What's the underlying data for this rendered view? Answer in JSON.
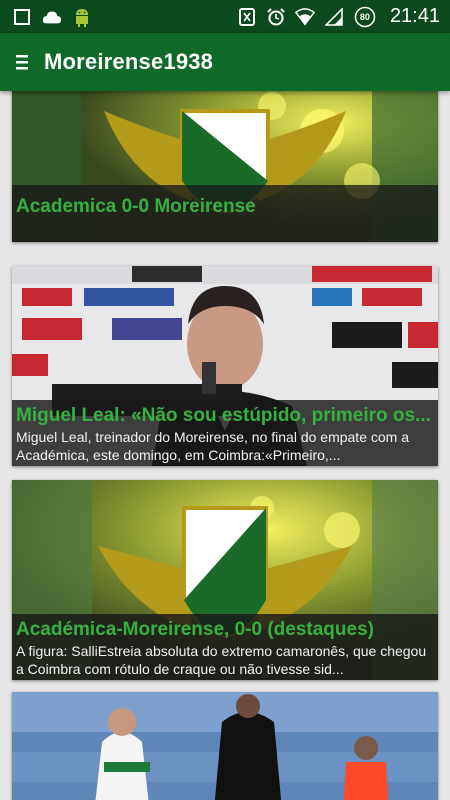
{
  "status_bar": {
    "time": "21:41",
    "battery_level": "80",
    "icons": [
      "stop-square-icon",
      "cloud-icon",
      "android-debug-icon",
      "nfc-icon",
      "alarm-icon",
      "wifi-icon",
      "signal-icon",
      "battery-icon"
    ]
  },
  "app_bar": {
    "title": "Moreirense1938",
    "menu_icon": "hamburger-menu-icon"
  },
  "colors": {
    "status_bar": "#0a4a1e",
    "app_bar": "#0f6a2a",
    "title_green": "#35b13e",
    "background": "#e6e6e6"
  },
  "feed": [
    {
      "title": "Academica 0-0 Moreirense",
      "description": "",
      "image": "moreirense-crest-over-match-photo"
    },
    {
      "title": "Miguel Leal: «Não sou estúpido, primeiro os...",
      "description": "Miguel Leal, treinador do Moreirense, no final do empate com a Académica, este domingo, em Coimbra:«Primeiro,...",
      "image": "coach-press-conference-photo"
    },
    {
      "title": "Académica-Moreirense, 0-0 (destaques)",
      "description": "A figura: SalliEstreia absoluta do extremo camaronês, que chegou a Coimbra com rótulo de craque ou não tivesse sid...",
      "image": "moreirense-crest-over-match-photo"
    },
    {
      "title": "",
      "description": "",
      "image": "match-action-photo"
    }
  ]
}
